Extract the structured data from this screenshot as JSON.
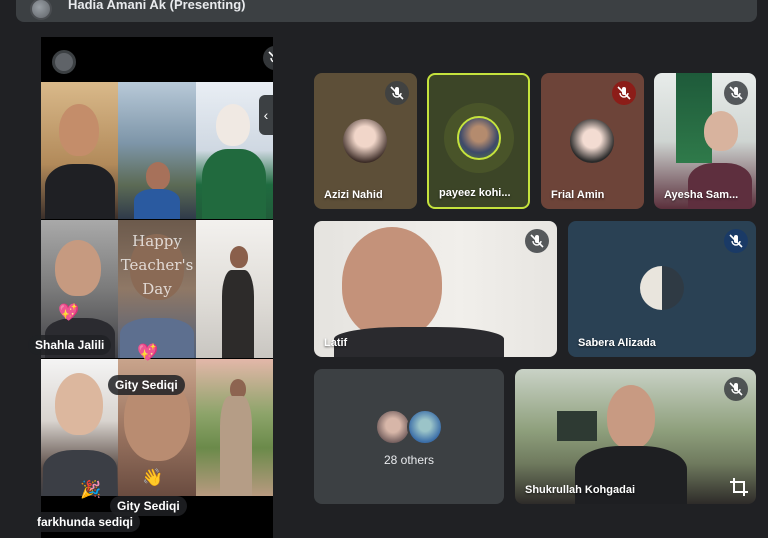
{
  "presenter": {
    "title": "Hadia Amani Ak (Presenting)"
  },
  "presentation": {
    "overlay_text_lines": [
      "Happy",
      "Teacher's",
      "Day"
    ],
    "name_labels": [
      {
        "text": "Shahla Jalili"
      },
      {
        "text": "Gity Sediqi"
      },
      {
        "text": "Gity Sediqi"
      },
      {
        "text": "farkhunda sediqi"
      }
    ],
    "emoji_reactions": [
      {
        "glyph": "💖"
      },
      {
        "glyph": "💖"
      },
      {
        "glyph": "👋"
      },
      {
        "glyph": "🎉"
      }
    ]
  },
  "participants": [
    {
      "name": "Azizi Nahid",
      "mic": "muted"
    },
    {
      "name": "payeez kohi...",
      "mic": "speaking"
    },
    {
      "name": "Frial Amin",
      "mic": "muted"
    },
    {
      "name": "Ayesha Sam...",
      "mic": "muted"
    },
    {
      "name": "Latif",
      "mic": "unmuted"
    },
    {
      "name": "Sabera Alizada",
      "mic": "muted"
    },
    {
      "name": "Shukrullah Kohgadai",
      "mic": "muted"
    }
  ],
  "others_tile": {
    "label": "28 others"
  },
  "colors": {
    "background": "#202124",
    "speaking_border": "#c5e33d",
    "muted_red": "#8c1d18",
    "tile_gray": "#3c4043"
  },
  "icons": {
    "mic_off": "mic-off-icon",
    "pin": "crop-icon",
    "handle": "chevron-left-icon"
  }
}
